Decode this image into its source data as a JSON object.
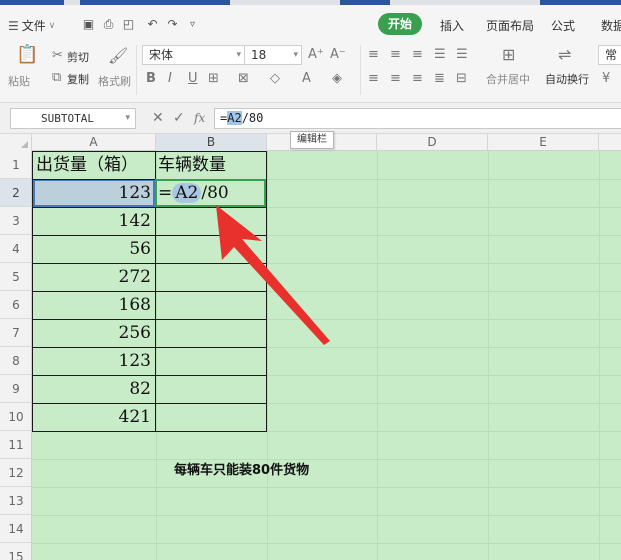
{
  "ribbon_tabs": {
    "file_menu": "文件",
    "home": "开始",
    "insert": "插入",
    "page_layout": "页面布局",
    "formulas": "公式",
    "data": "数据"
  },
  "clipboard": {
    "paste": "粘贴",
    "cut": "剪切",
    "copy": "复制",
    "format_painter": "格式刷"
  },
  "font": {
    "name": "宋体",
    "size": "18"
  },
  "alignment": {
    "merge_center": "合并居中",
    "wrap_text": "自动换行"
  },
  "number_format": "常",
  "formula_bar": {
    "name_box": "SUBTOTAL",
    "fx": "fx",
    "formula_prefix": "=",
    "formula_ref": "A2",
    "formula_suffix": "/80",
    "tooltip": "编辑栏"
  },
  "columns": [
    "A",
    "B",
    "D",
    "E"
  ],
  "rows": [
    "1",
    "2",
    "3",
    "4",
    "5",
    "6",
    "7",
    "8",
    "9",
    "10",
    "11",
    "12",
    "13",
    "14",
    "15"
  ],
  "cells": {
    "A1": "出货量（箱）",
    "B1": "车辆数量",
    "A_values": [
      "123",
      "142",
      "56",
      "272",
      "168",
      "256",
      "123",
      "82",
      "421"
    ],
    "B2_eq": "=",
    "B2_ref": "A2",
    "B2_rest": "/80"
  },
  "note": "每辆车只能装80件货物",
  "colors": {
    "grid_background": "#c8ebc8",
    "home_tab": "#3a9f4f",
    "arrow": "#e8302c",
    "selected_cell": "#bcd0dc"
  }
}
